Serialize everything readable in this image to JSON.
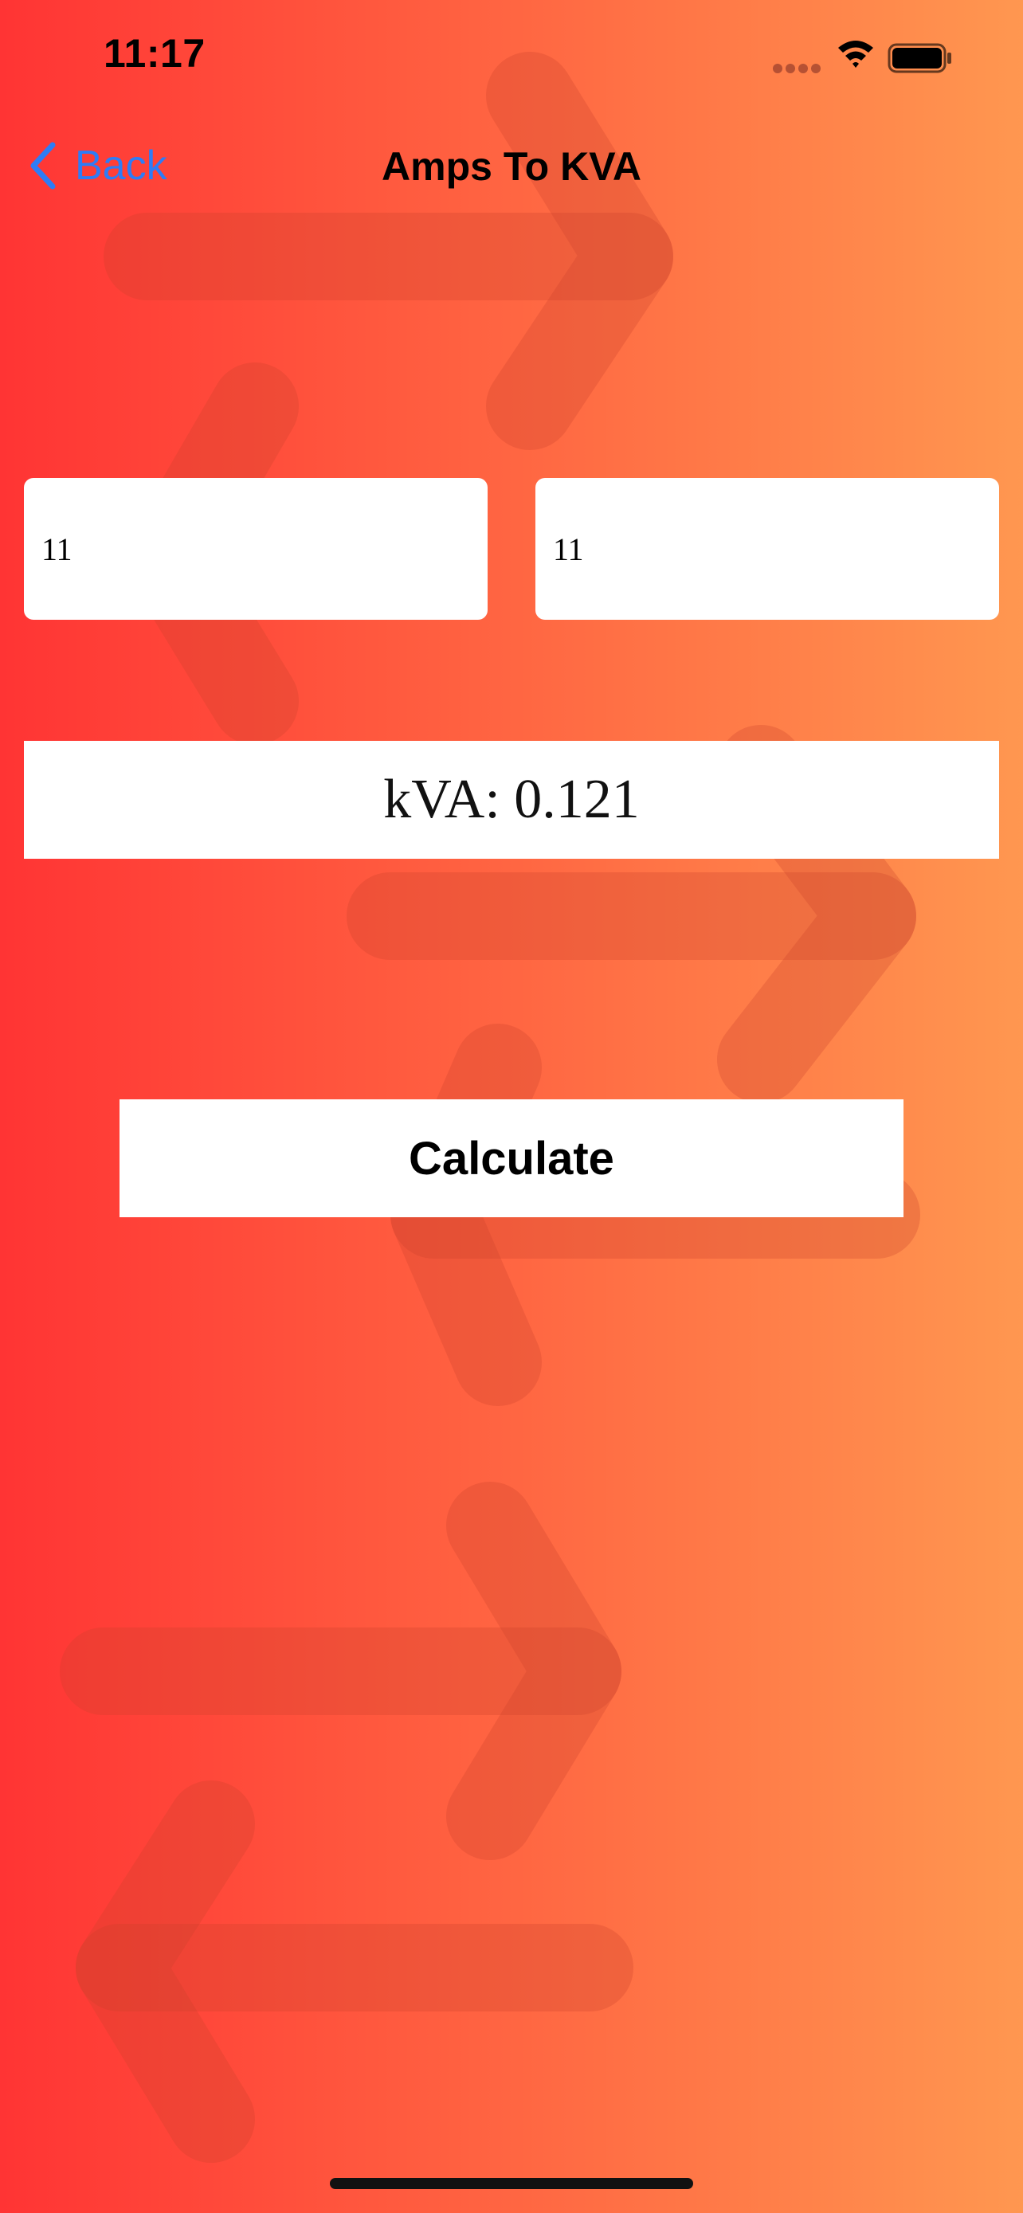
{
  "status_bar": {
    "time": "11:17",
    "icons": [
      "signal-dots-icon",
      "wifi-icon",
      "battery-icon"
    ]
  },
  "nav": {
    "back_label": "Back",
    "back_icon": "chevron-left-icon",
    "title": "Amps To KVA"
  },
  "form": {
    "amps_value": "11",
    "volts_value": "11"
  },
  "result": {
    "text": "kVA: 0.121"
  },
  "actions": {
    "calculate_label": "Calculate"
  },
  "theme": {
    "gradient_start": "#ff3434",
    "gradient_end": "#ff9750",
    "accent": "#2e7cf6",
    "arrow_overlay": "#d2412f"
  },
  "background_icons": [
    "arrow-right-icon",
    "arrow-left-icon"
  ]
}
